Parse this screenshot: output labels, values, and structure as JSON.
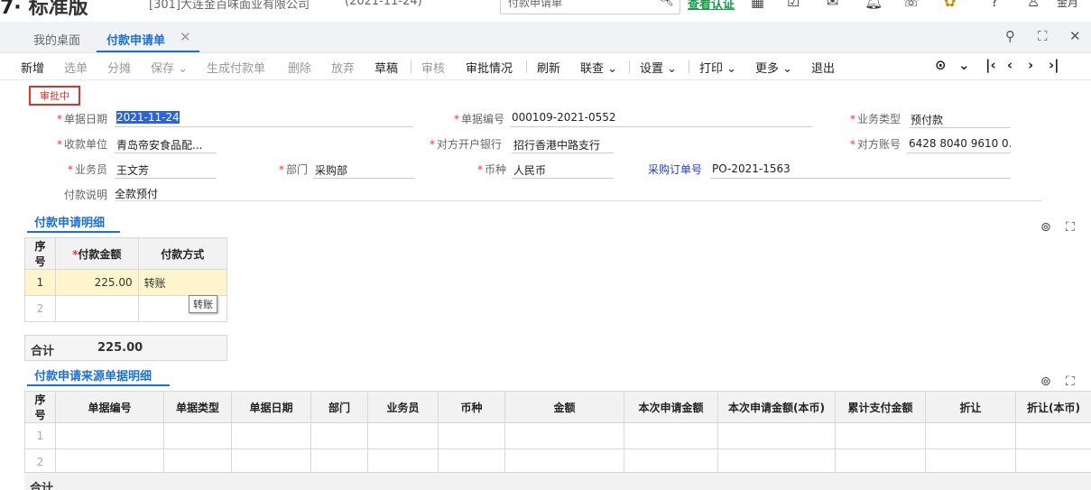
{
  "header": {
    "logo_mark": "7·",
    "logo_text": "标准版",
    "company": "[301]大连金百味面业有限公司",
    "date": "(2021-11-24)",
    "search_value": "付款申请单",
    "auth_link": "查看认证",
    "user_name": "金月"
  },
  "tabs": [
    {
      "label": "我的桌面"
    },
    {
      "label": "付款申请单"
    }
  ],
  "toolbar": {
    "new": "新增",
    "select": "选单",
    "split": "分摊",
    "save": "保存",
    "gen_payment": "生成付款单",
    "delete": "删除",
    "abandon": "放弃",
    "draft": "草稿",
    "audit": "审核",
    "approval_status": "审批情况",
    "refresh": "刷新",
    "linked_query": "联查",
    "settings": "设置",
    "print": "打印",
    "more": "更多",
    "exit": "退出"
  },
  "status_badge": "审批中",
  "form": {
    "doc_date_label": "单据日期",
    "doc_date": "2021-11-24",
    "doc_no_label": "单据编号",
    "doc_no": "000109-2021-0552",
    "biz_type_label": "业务类型",
    "biz_type": "预付款",
    "payee_label": "收款单位",
    "payee": "青岛帝安食品配...",
    "bank_label": "对方开户银行",
    "bank": "招行香港中路支行",
    "account_label": "对方账号",
    "account": "6428 8040 9610 0...",
    "staff_label": "业务员",
    "staff": "王文芳",
    "dept_label": "部门",
    "dept": "采购部",
    "currency_label": "币种",
    "currency": "人民币",
    "po_label": "采购订单号",
    "po": "PO-2021-1563",
    "desc_label": "付款说明",
    "desc": "全款预付"
  },
  "detail": {
    "title": "付款申请明细",
    "headers": {
      "idx": "序号",
      "amount": "付款金额",
      "method": "付款方式"
    },
    "rows": [
      {
        "idx": "1",
        "amount": "225.00",
        "method": "转账"
      },
      {
        "idx": "2",
        "amount": "",
        "method": ""
      }
    ],
    "tooltip": "转账",
    "total_label": "合计",
    "total_value": "225.00"
  },
  "source": {
    "title": "付款申请来源单据明细",
    "headers": [
      "序号",
      "单据编号",
      "单据类型",
      "单据日期",
      "部门",
      "业务员",
      "币种",
      "金额",
      "本次申请金额",
      "本次申请金额(本币)",
      "累计支付金额",
      "折让",
      "折让(本币)"
    ],
    "rows": [
      [
        "1"
      ],
      [
        "2"
      ]
    ],
    "total_label": "合计"
  },
  "colors": {
    "accent": "#1f6fd1",
    "badge": "#d9342b",
    "active_row": "#fff5cc"
  }
}
